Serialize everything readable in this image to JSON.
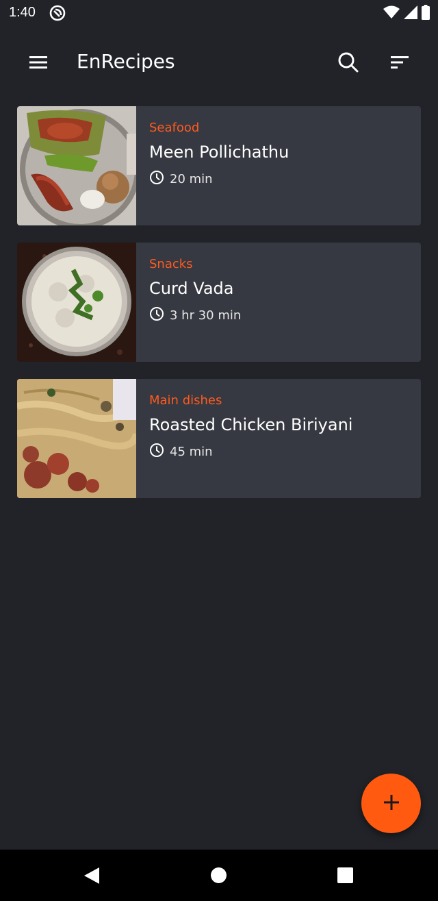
{
  "status_bar": {
    "time": "1:40",
    "icons": [
      "do-not-disturb-icon",
      "wifi-icon",
      "signal-icon",
      "battery-icon"
    ]
  },
  "app_bar": {
    "title": "EnRecipes",
    "icons": [
      "menu-icon",
      "search-icon",
      "sort-icon"
    ]
  },
  "recipes": [
    {
      "category": "Seafood",
      "title": "Meen Pollichathu",
      "time": "20 min"
    },
    {
      "category": "Snacks",
      "title": "Curd Vada",
      "time": "3 hr 30 min"
    },
    {
      "category": "Main dishes",
      "title": "Roasted Chicken Biriyani",
      "time": "45 min"
    }
  ],
  "fab": {
    "icon": "plus-icon"
  },
  "nav_bar": {
    "icons": [
      "back-icon",
      "home-icon",
      "recents-icon"
    ]
  },
  "colors": {
    "background": "#212328",
    "card": "#363941",
    "accent": "#ff5a1f",
    "text": "#ffffff"
  }
}
